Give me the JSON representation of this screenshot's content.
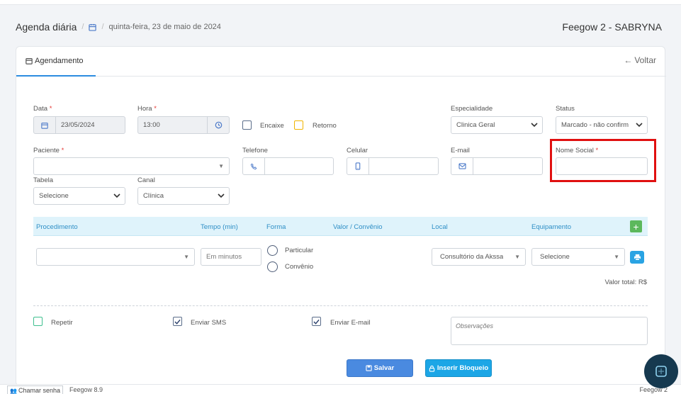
{
  "header": {
    "title": "Agenda diária",
    "date": "quinta-feira, 23 de maio de 2024",
    "user": "Feegow 2 - SABRYNA"
  },
  "tabs": {
    "active": "Agendamento",
    "back": "Voltar"
  },
  "form": {
    "date": {
      "label": "Data",
      "value": "23/05/2024"
    },
    "time": {
      "label": "Hora",
      "value": "13:00"
    },
    "encaixe": "Encaixe",
    "retorno": "Retorno",
    "specialty": {
      "label": "Especialidade",
      "value": "Clinica Geral"
    },
    "status": {
      "label": "Status",
      "value": "Marcado - não confirm"
    },
    "patient": {
      "label": "Paciente"
    },
    "phone": {
      "label": "Telefone"
    },
    "cell": {
      "label": "Celular"
    },
    "email": {
      "label": "E-mail"
    },
    "social_name": {
      "label": "Nome Social"
    },
    "table": {
      "label": "Tabela",
      "value": "Selecione"
    },
    "channel": {
      "label": "Canal",
      "value": "Clínica"
    },
    "required_mark": "*"
  },
  "procedures": {
    "headers": [
      "Procedimento",
      "Tempo (min)",
      "Forma",
      "Valor / Convênio",
      "Local",
      "Equipamento"
    ],
    "time_placeholder": "Em minutos",
    "payment_options": [
      "Particular",
      "Convênio"
    ],
    "local": "Consultório da Akssa",
    "equipment": "Selecione",
    "total": "Valor total: R$"
  },
  "options": {
    "repeat": "Repetir",
    "sms": "Enviar SMS",
    "email": "Enviar E-mail",
    "notes_placeholder": "Observações"
  },
  "actions": {
    "save": "Salvar",
    "block": "Inserir Bloqueio"
  },
  "footer": {
    "call": "Chamar senha",
    "version": "Feegow 8.9",
    "brand": "Feegow 2"
  },
  "colors": {
    "accent": "#2c8ce0",
    "required": "#e53935",
    "highlight": "#e01010",
    "add": "#5cb85c",
    "retorno": "#f0b400",
    "repeat": "#3fbf8f"
  }
}
